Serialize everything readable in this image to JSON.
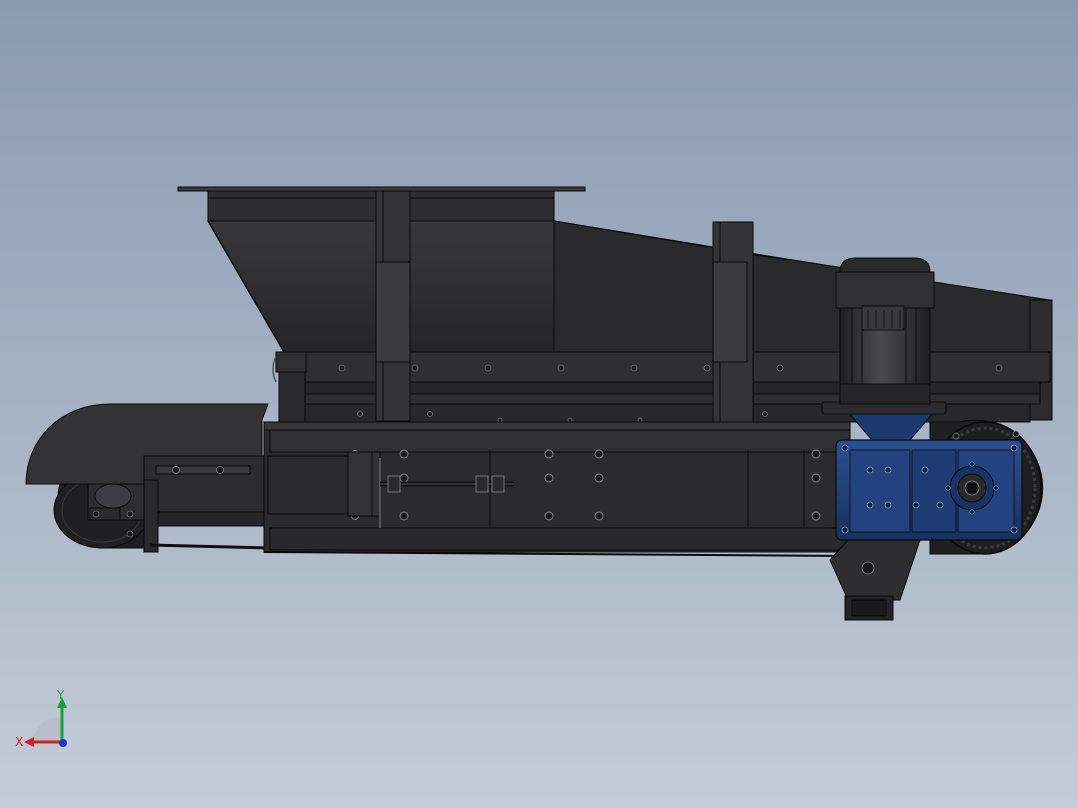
{
  "view": {
    "orientation": "front",
    "colors": {
      "background_top": "#8a9ab0",
      "background_bottom": "#c4ccd8",
      "body": "#2b2b2e",
      "body_shade": "#232326",
      "edge": "#0a0a0a",
      "gearbox": "#1f3f7a",
      "motor": "#333336"
    }
  },
  "triad": {
    "x_label": "X",
    "y_label": "Y",
    "x_color": "#d42020",
    "y_color": "#1aa03a",
    "z_color": "#2233cc"
  }
}
